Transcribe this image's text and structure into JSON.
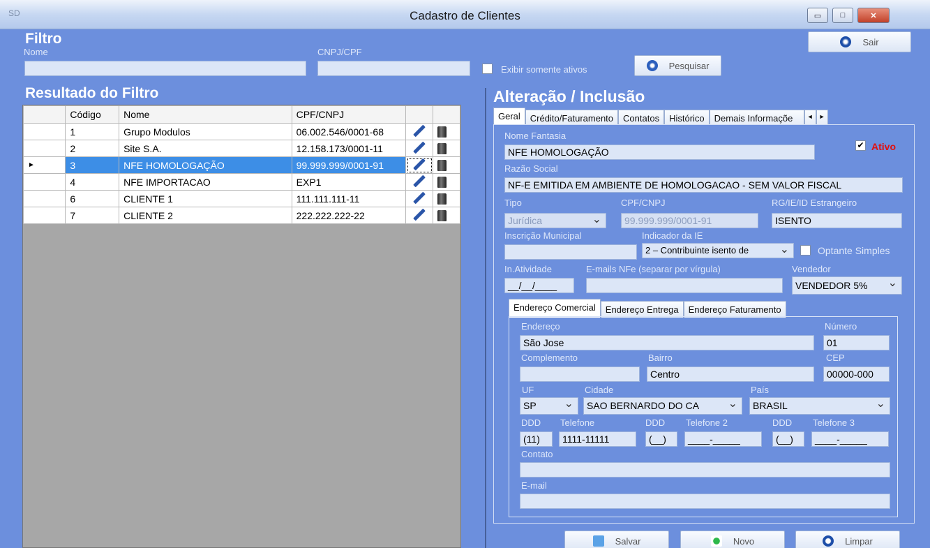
{
  "window": {
    "title": "Cadastro de Clientes",
    "app_icon": "SD",
    "min": "▭",
    "max": "□",
    "close": "✕"
  },
  "filter": {
    "heading": "Filtro",
    "nome_label": "Nome",
    "cnpj_label": "CNPJ/CPF",
    "nome_value": "",
    "cnpj_value": "",
    "only_active_label": "Exibir somente ativos",
    "search_button": "Pesquisar",
    "exit_button": "Sair"
  },
  "results": {
    "heading": "Resultado do Filtro",
    "columns": [
      "Código",
      "Nome",
      "CPF/CNPJ"
    ],
    "rows": [
      {
        "codigo": "1",
        "nome": "Grupo Modulos",
        "doc": "06.002.546/0001-68"
      },
      {
        "codigo": "2",
        "nome": "Site S.A.",
        "doc": "12.158.173/0001-11"
      },
      {
        "codigo": "3",
        "nome": "NFE HOMOLOGAÇÃO",
        "doc": "99.999.999/0001-91"
      },
      {
        "codigo": "4",
        "nome": "NFE IMPORTACAO",
        "doc": "EXP1"
      },
      {
        "codigo": "6",
        "nome": "CLIENTE 1",
        "doc": "111.111.111-11"
      },
      {
        "codigo": "7",
        "nome": "CLIENTE 2",
        "doc": "222.222.222-22"
      }
    ],
    "selected_marker": "►"
  },
  "edit": {
    "heading": "Alteração / Inclusão",
    "tabs": [
      "Geral",
      "Crédito/Faturamento",
      "Contatos",
      "Histórico",
      "Demais Informaçõe"
    ],
    "scroll_left": "◄",
    "scroll_right": "►",
    "nome_fantasia_label": "Nome Fantasia",
    "nome_fantasia": "NFE HOMOLOGAÇÃO",
    "ativo_label": "Ativo",
    "razao_label": "Razão Social",
    "razao": "NF-E EMITIDA EM AMBIENTE DE HOMOLOGACAO - SEM VALOR FISCAL",
    "tipo_label": "Tipo",
    "tipo": "Jurídica",
    "cpf_label": "CPF/CNPJ",
    "cpf": "99.999.999/0001-91",
    "rg_label": "RG/IE/ID Estrangeiro",
    "rg": "ISENTO",
    "insc_mun_label": "Inscrição Municipal",
    "insc_mun": "",
    "ind_ie_label": "Indicador da  IE",
    "ind_ie": "2 – Contribuinte isento de",
    "optante_label": "Optante Simples",
    "in_atividade_label": "In.Atividade",
    "in_atividade": "__/__/____",
    "emails_label": "E-mails NFe (separar por vírgula)",
    "emails": "",
    "vendedor_label": "Vendedor",
    "vendedor": "VENDEDOR 5%",
    "addr_tabs": [
      "Endereço Comercial",
      "Endereço Entrega",
      "Endereço Faturamento"
    ],
    "endereco_label": "Endereço",
    "endereco": "São Jose",
    "numero_label": "Número",
    "numero": "01",
    "complemento_label": "Complemento",
    "complemento": "",
    "bairro_label": "Bairro",
    "bairro": "Centro",
    "cep_label": "CEP",
    "cep": "00000-000",
    "uf_label": "UF",
    "uf": "SP",
    "cidade_label": "Cidade",
    "cidade": "SAO BERNARDO DO CA",
    "pais_label": "País",
    "pais": "BRASIL",
    "ddd_label": "DDD",
    "tel_label": "Telefone",
    "tel2_label": "Telefone 2",
    "tel3_label": "Telefone 3",
    "ddd1": "(11)",
    "tel1": "1111-11111",
    "ddd2": "(__)",
    "tel2": "____-_____",
    "ddd3": "(__)",
    "tel3": "____-_____",
    "contato_label": "Contato",
    "contato": "",
    "email_label": "E-mail",
    "email": ""
  },
  "actions": {
    "salvar": "Salvar",
    "novo": "Novo",
    "limpar": "Limpar"
  }
}
